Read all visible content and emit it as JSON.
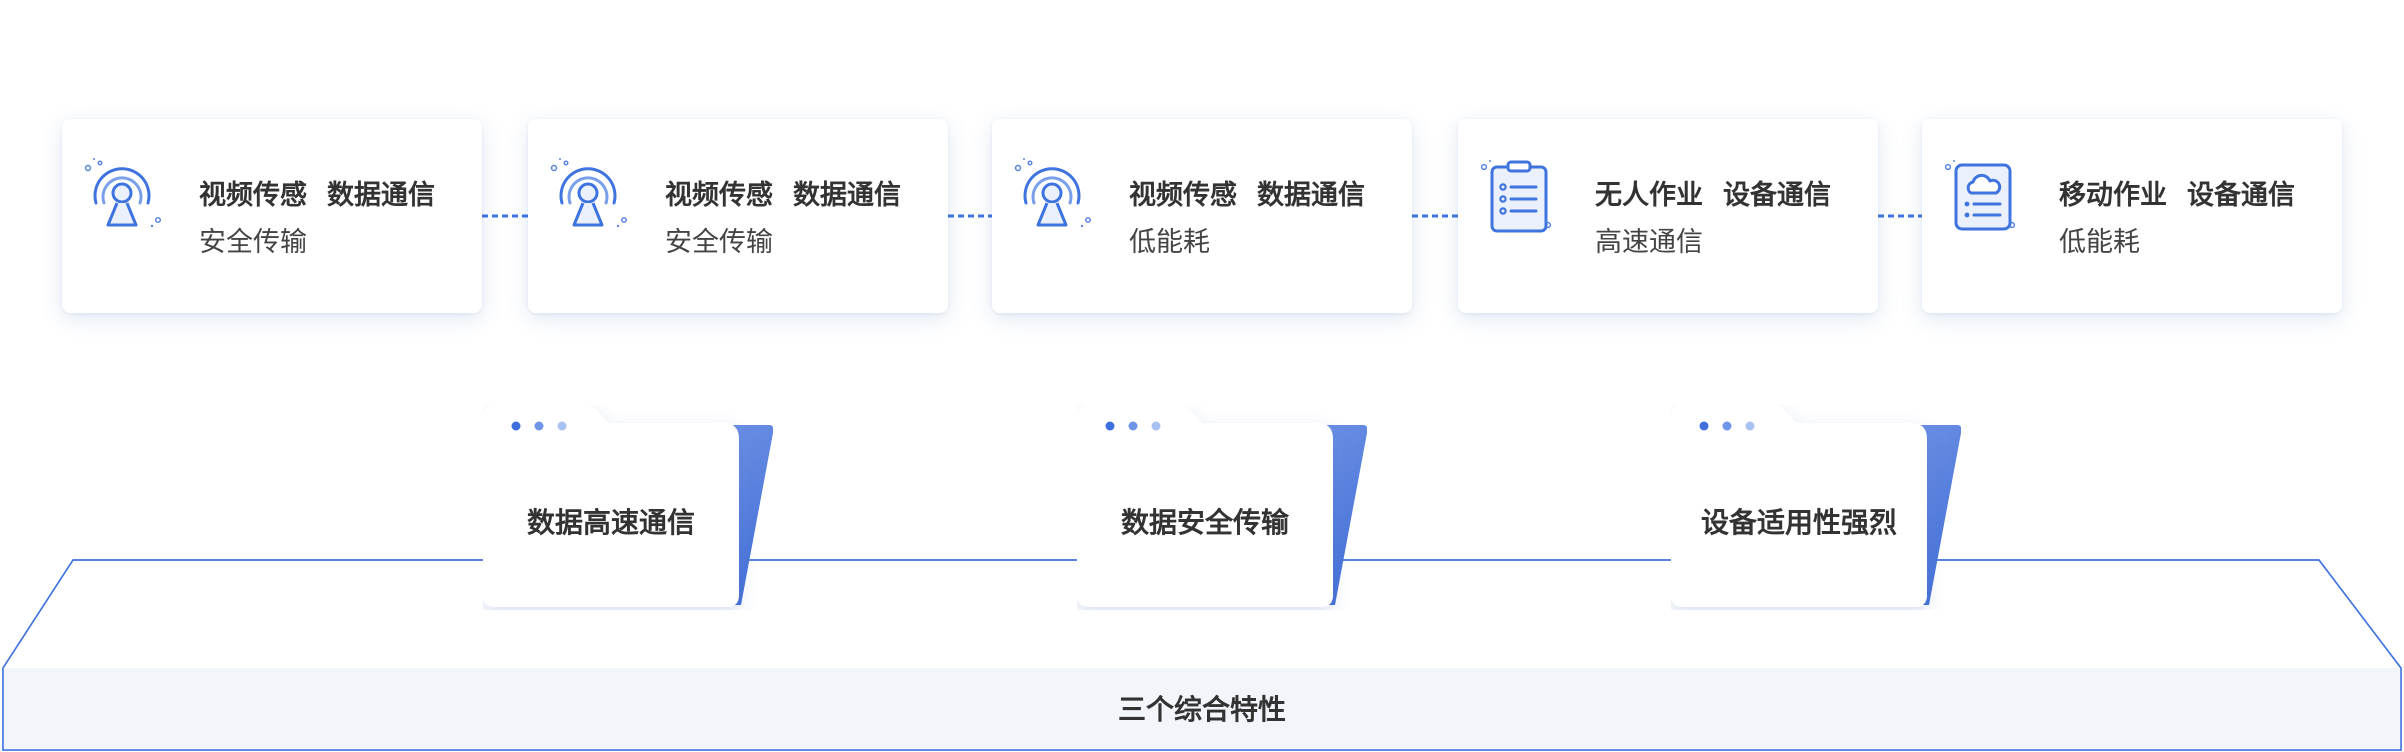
{
  "cards": [
    {
      "title_a": "视频传感",
      "title_b": "数据通信",
      "subtitle": "安全传输",
      "icon": "signal-tower-icon"
    },
    {
      "title_a": "视频传感",
      "title_b": "数据通信",
      "subtitle": "安全传输",
      "icon": "signal-tower-icon"
    },
    {
      "title_a": "视频传感",
      "title_b": "数据通信",
      "subtitle": "低能耗",
      "icon": "signal-tower-icon"
    },
    {
      "title_a": "无人作业",
      "title_b": "设备通信",
      "subtitle": "高速通信",
      "icon": "clipboard-list-icon"
    },
    {
      "title_a": "移动作业",
      "title_b": "设备通信",
      "subtitle": "低能耗",
      "icon": "cloud-document-icon"
    }
  ],
  "features": [
    {
      "label": "数据高速通信",
      "icon": "folder-icon"
    },
    {
      "label": "数据安全传输",
      "icon": "folder-icon"
    },
    {
      "label": "设备适用性强烈",
      "icon": "folder-icon"
    }
  ],
  "base": {
    "label": "三个综合特性"
  },
  "colors": {
    "accent": "#3f73de",
    "folder_back": "#5b86e0",
    "platform_fill": "#f2f5fa",
    "dots": [
      "#3f6fde",
      "#6f95e8",
      "#a9c1f2"
    ]
  }
}
